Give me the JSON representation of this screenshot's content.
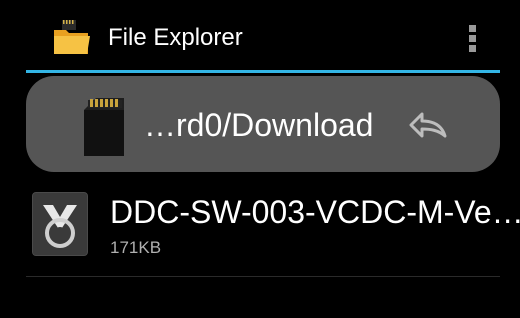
{
  "action_bar": {
    "title": "File Explorer",
    "app_icon": "folder-sd-icon",
    "overflow_icon": "overflow-menu-icon"
  },
  "path_bar": {
    "path": "…rd0/Download",
    "storage_icon": "sd-card-icon",
    "back_icon": "back-arrow-icon"
  },
  "files": [
    {
      "name": "DDC-SW-003-VCDC-M-Ve…",
      "size": "171KB",
      "icon": "app-file-icon"
    }
  ],
  "colors": {
    "accent": "#33b5e5",
    "background": "#000000",
    "path_bar": "#555555",
    "secondary_text": "#b0b0b0"
  }
}
